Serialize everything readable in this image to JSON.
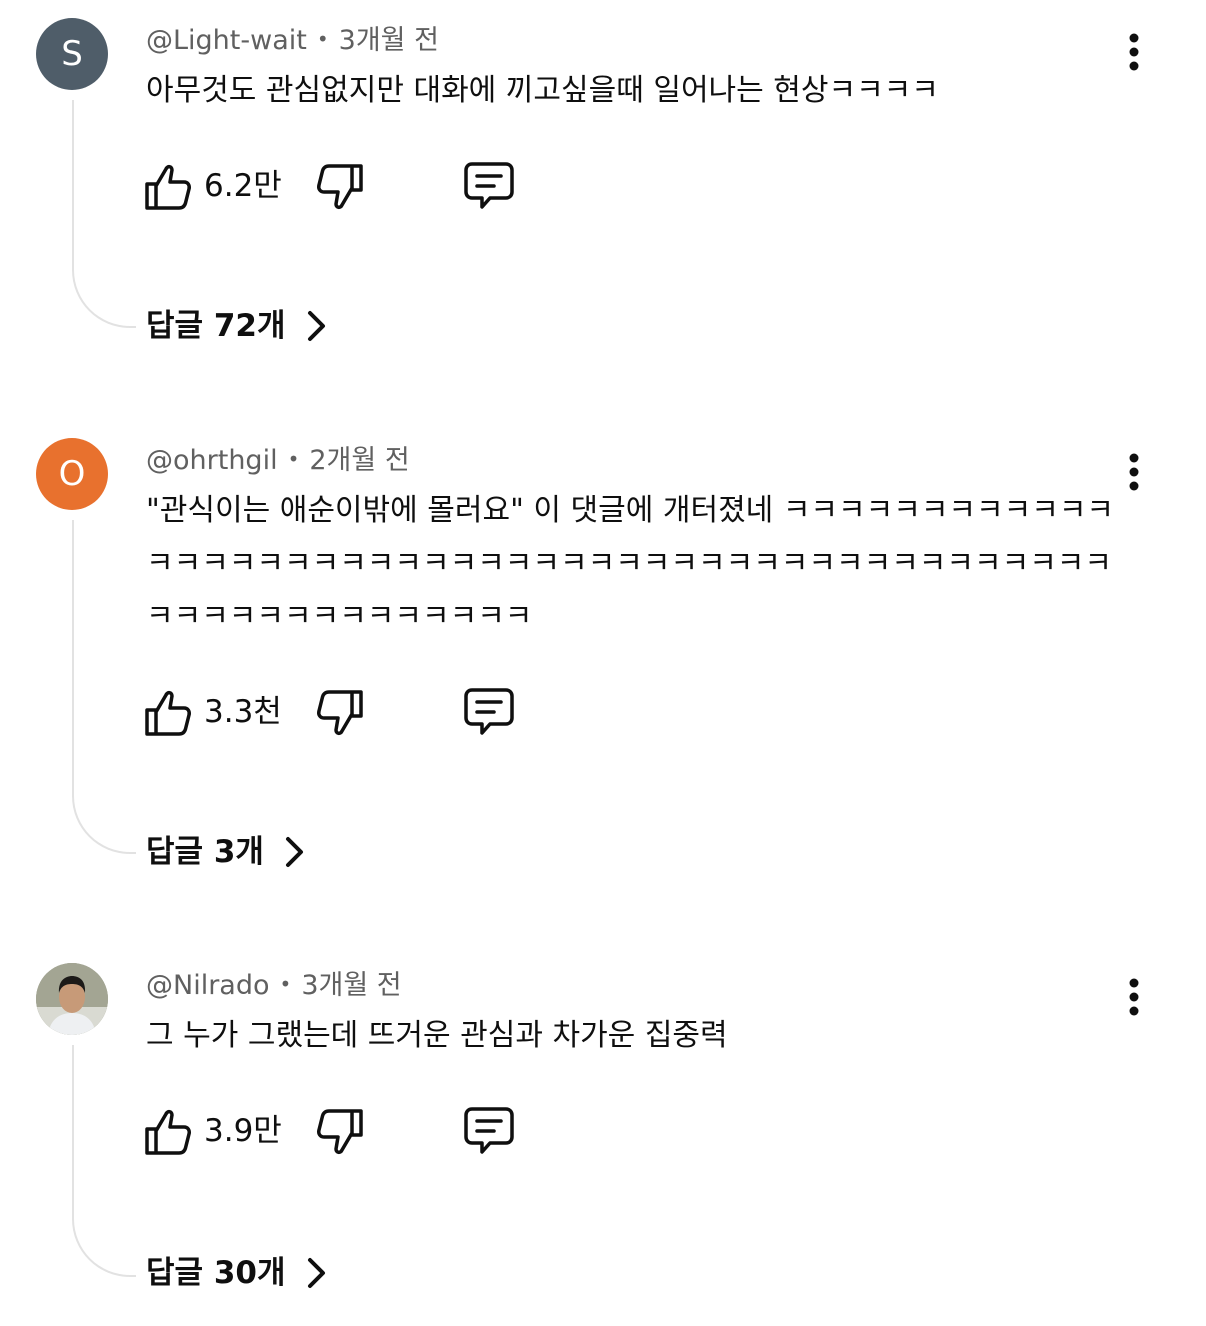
{
  "comments": [
    {
      "author": "@Light-wait",
      "time": "3개월 전",
      "avatar_letter": "S",
      "avatar_color": "#4f5d69",
      "text": "아무것도 관심없지만 대화에 끼고싶을때 일어나는 현상ㅋㅋㅋㅋ",
      "likes": "6.2만",
      "replies_label": "답글 72개"
    },
    {
      "author": "@ohrthgil",
      "time": "2개월 전",
      "avatar_letter": "O",
      "avatar_color": "#e8712e",
      "text": "\"관식이는 애순이밖에 몰러요\" 이 댓글에 개터졌네 ㅋㅋㅋㅋㅋㅋㅋㅋㅋㅋㅋㅋㅋㅋㅋㅋㅋㅋㅋㅋㅋㅋㅋㅋㅋㅋㅋㅋㅋㅋㅋㅋㅋㅋㅋㅋㅋㅋㅋㅋㅋㅋㅋㅋㅋㅋㅋㅋㅋㅋㅋㅋㅋㅋㅋㅋㅋㅋㅋㅋㅋ",
      "likes": "3.3천",
      "replies_label": "답글 3개"
    },
    {
      "author": "@Nilrado",
      "time": "3개월 전",
      "avatar_letter": "",
      "avatar_color": "#8a8f7e",
      "text": "그 누가 그랬는데 뜨거운 관심과 차가운 집중력",
      "likes": "3.9만",
      "replies_label": "답글 30개"
    }
  ],
  "icons": {
    "avatar_photo": "person-photo",
    "like": "thumbs-up-icon",
    "dislike": "thumbs-down-icon",
    "reply": "comment-bubble-icon",
    "more": "vertical-ellipsis-icon",
    "replies": "chevron-right-icon"
  }
}
